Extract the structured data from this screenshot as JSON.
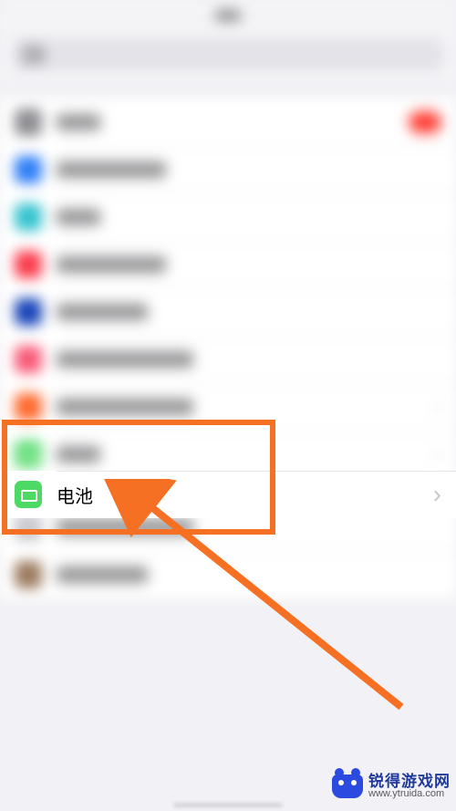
{
  "highlighted_row": {
    "label": "电池",
    "icon": "battery-icon"
  },
  "annotation": {
    "highlight_color": "#f57023",
    "arrow_color": "#f57023"
  },
  "watermark": {
    "name_cn": "锐得游戏网",
    "url": "www.ytruida.com"
  }
}
